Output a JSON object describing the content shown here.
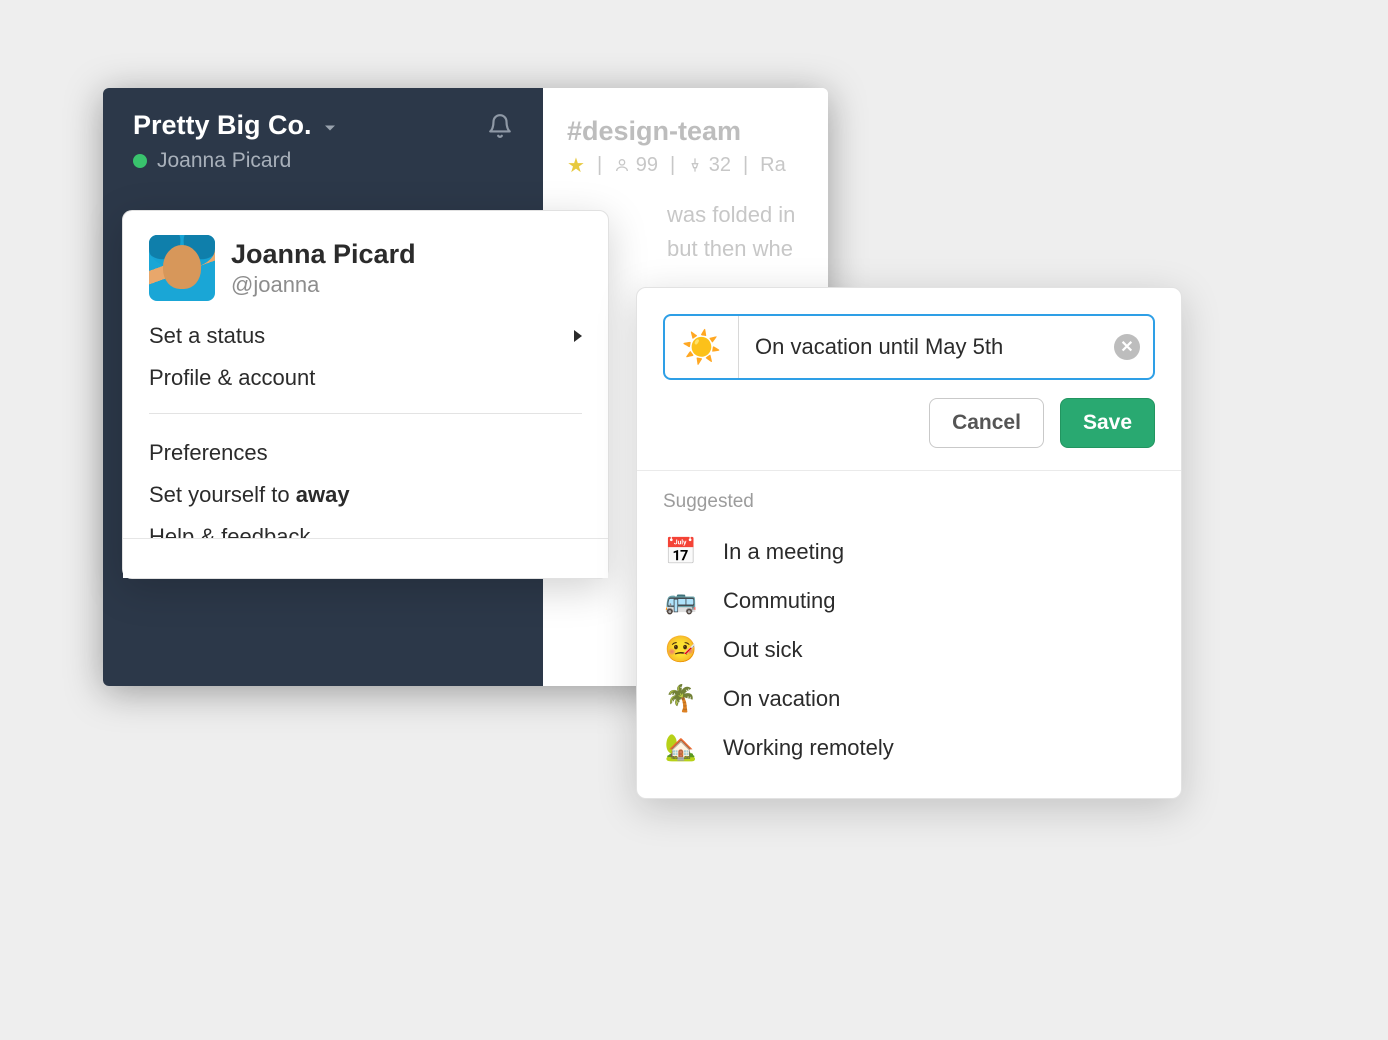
{
  "workspace": {
    "name": "Pretty Big Co.",
    "user_display": "Joanna Picard"
  },
  "channel": {
    "name": "#design-team",
    "members": "99",
    "pins": "32",
    "topic_fragment": "Ra",
    "msg_line1": "was folded in",
    "msg_line2": "but then whe"
  },
  "dropdown": {
    "user_name": "Joanna Picard",
    "user_handle": "@joanna",
    "items": {
      "set_status": "Set a status",
      "profile": "Profile & account",
      "preferences": "Preferences",
      "set_away_prefix": "Set yourself to ",
      "set_away_strong": "away",
      "help": "Help & feedback"
    }
  },
  "status_modal": {
    "emoji": "☀️",
    "input_value": "On vacation until May 5th",
    "cancel_label": "Cancel",
    "save_label": "Save",
    "suggested_label": "Suggested",
    "suggestions": [
      {
        "emoji": "📅",
        "label": "In a meeting"
      },
      {
        "emoji": "🚌",
        "label": "Commuting"
      },
      {
        "emoji": "🤒",
        "label": "Out sick"
      },
      {
        "emoji": "🌴",
        "label": "On vacation"
      },
      {
        "emoji": "🏡",
        "label": "Working remotely"
      }
    ]
  }
}
